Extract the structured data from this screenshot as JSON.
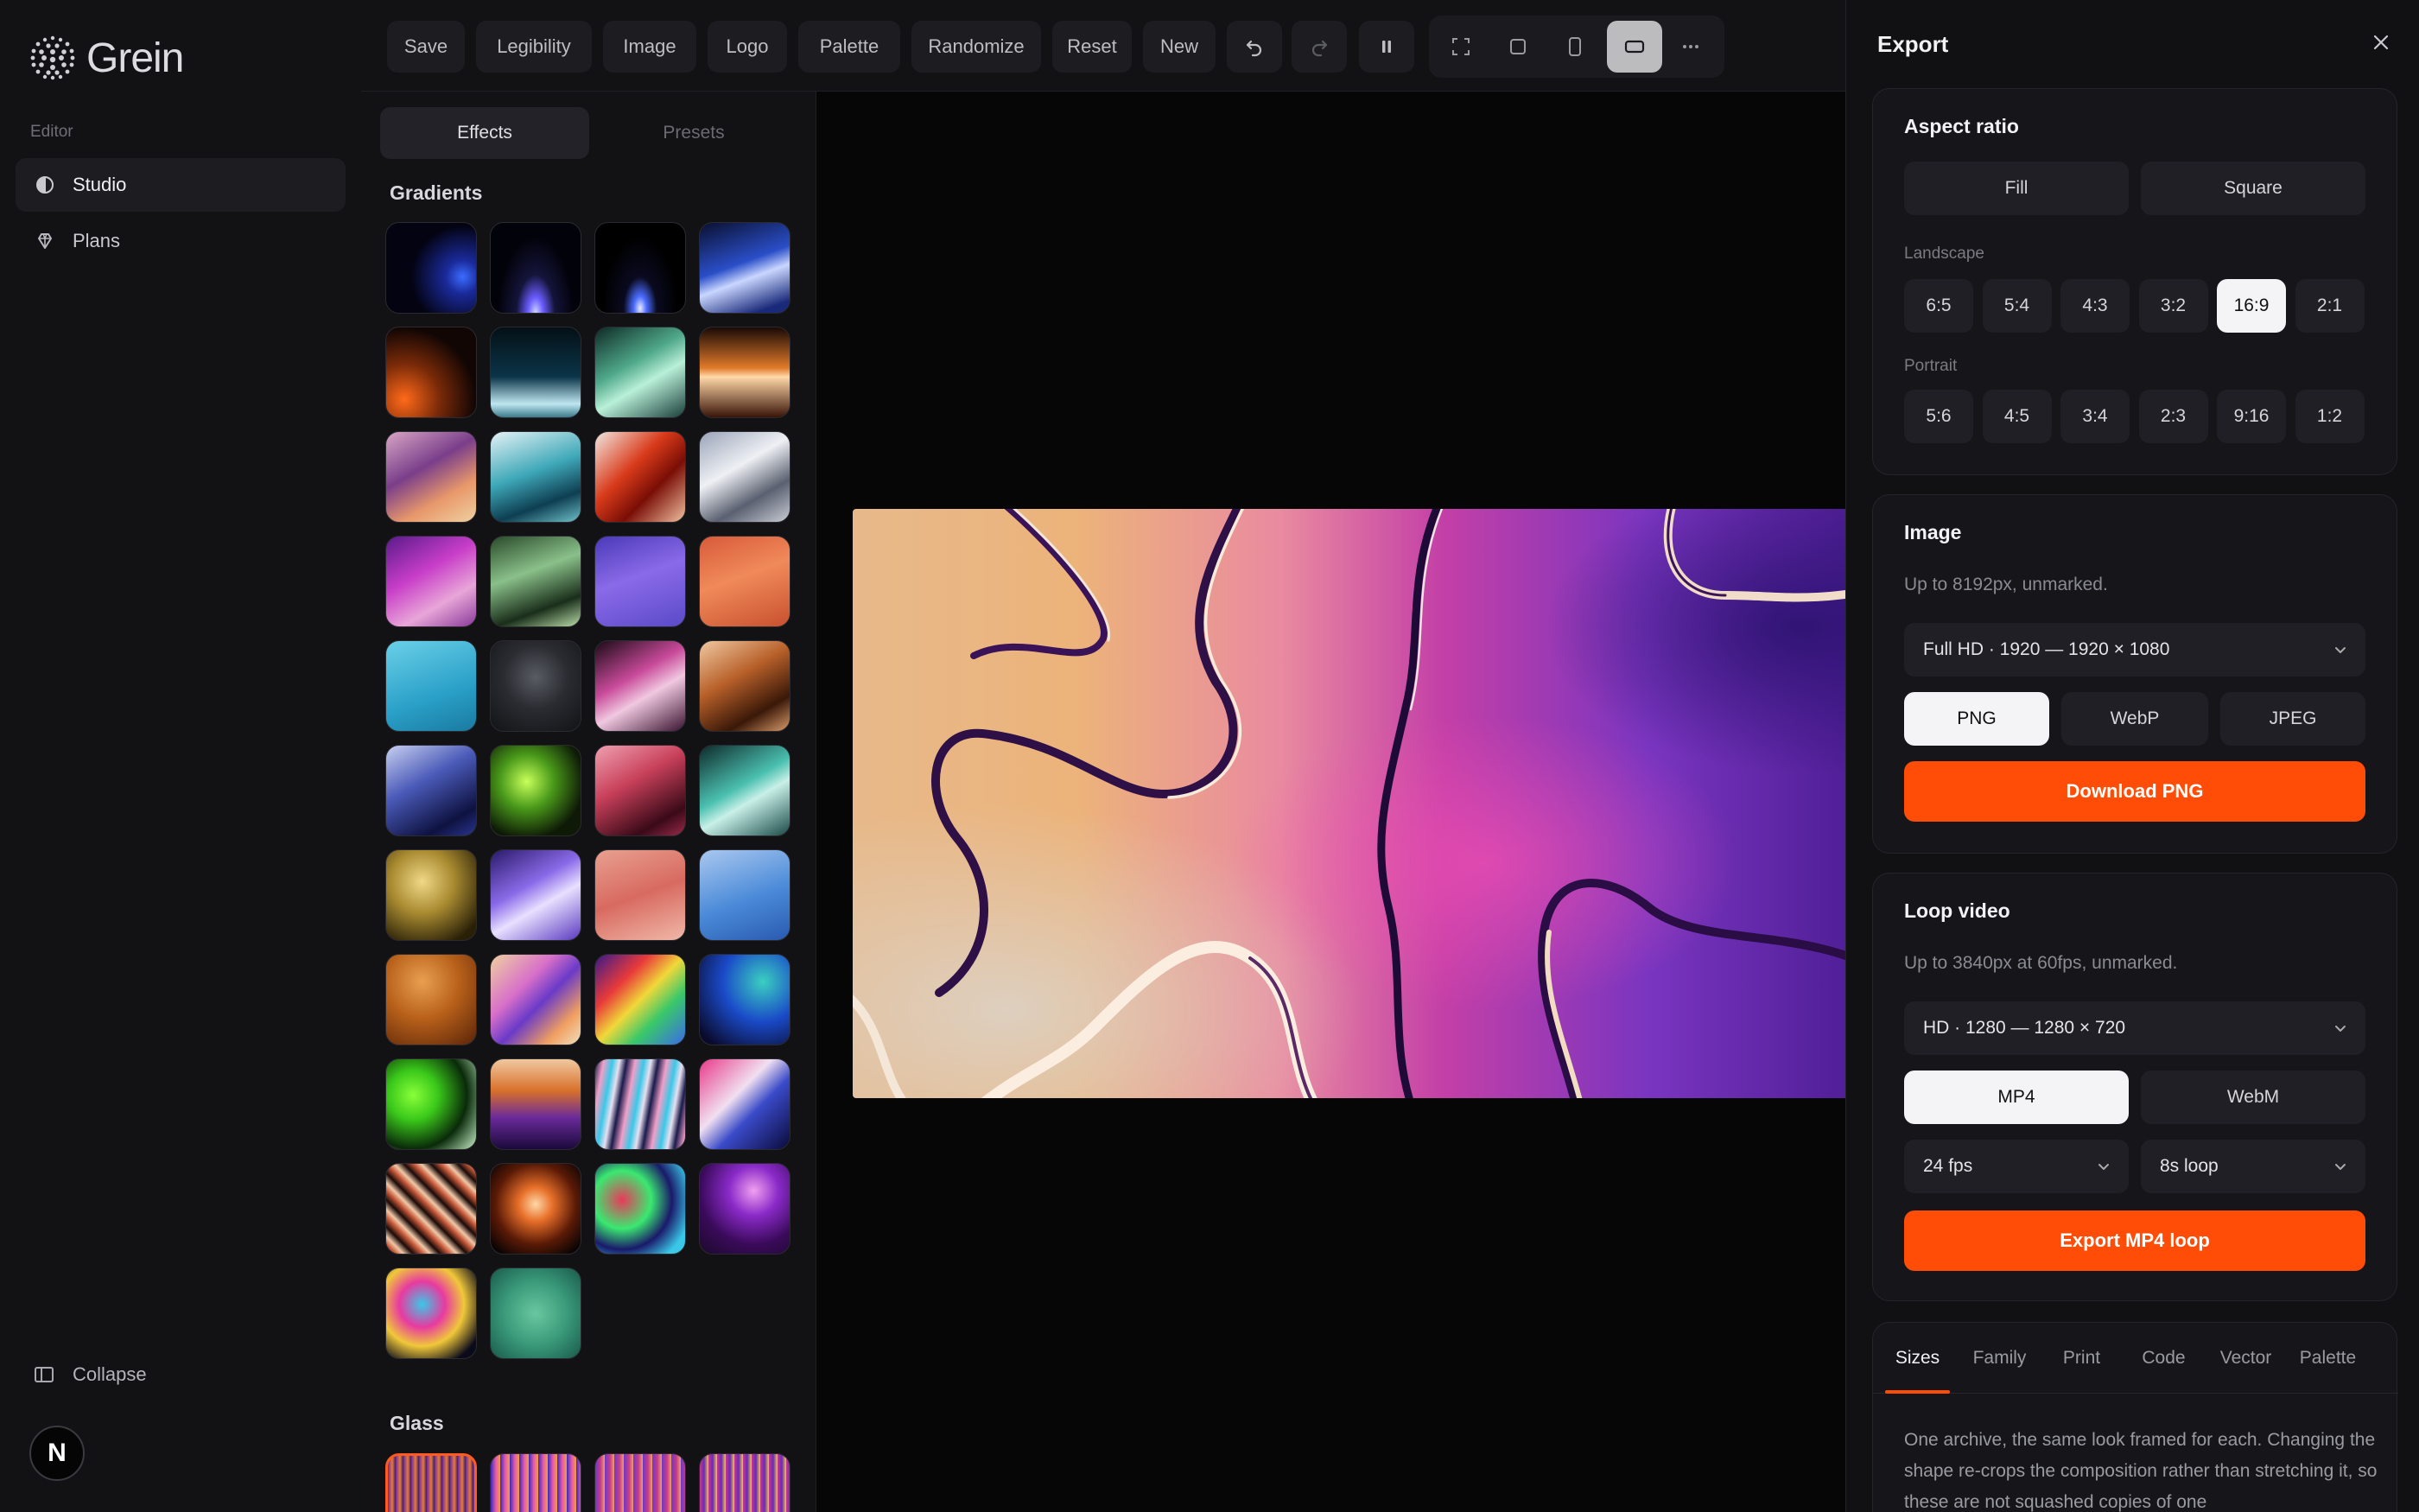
{
  "app": {
    "name": "Grein"
  },
  "sidebar": {
    "section": "Editor",
    "items": [
      {
        "label": "Studio",
        "icon": "studio-icon",
        "active": true
      },
      {
        "label": "Plans",
        "icon": "gem-icon",
        "active": false
      }
    ],
    "collapse_label": "Collapse",
    "avatar_letter": "N"
  },
  "toolbar": {
    "save": "Save",
    "legibility": "Legibility",
    "image": "Image",
    "logo": "Logo",
    "palette": "Palette",
    "randomize": "Randomize",
    "reset": "Reset",
    "new": "New"
  },
  "effects_panel": {
    "tab_effects": "Effects",
    "tab_presets": "Presets",
    "gradients_title": "Gradients",
    "glass_title": "Glass"
  },
  "export": {
    "title": "Export",
    "aspect": {
      "title": "Aspect ratio",
      "fill": "Fill",
      "square": "Square",
      "landscape_label": "Landscape",
      "landscape": [
        "6:5",
        "5:4",
        "4:3",
        "3:2",
        "16:9",
        "2:1"
      ],
      "landscape_selected": "16:9",
      "portrait_label": "Portrait",
      "portrait": [
        "5:6",
        "4:5",
        "3:4",
        "2:3",
        "9:16",
        "1:2"
      ]
    },
    "image": {
      "title": "Image",
      "subtitle": "Up to 8192px, unmarked.",
      "size_value": "Full HD · 1920 — 1920 × 1080",
      "formats": [
        "PNG",
        "WebP",
        "JPEG"
      ],
      "format_selected": "PNG",
      "cta": "Download PNG"
    },
    "video": {
      "title": "Loop video",
      "subtitle": "Up to 3840px at 60fps, unmarked.",
      "size_value": "HD · 1280 — 1280 × 720",
      "formats": [
        "MP4",
        "WebM"
      ],
      "format_selected": "MP4",
      "fps_value": "24 fps",
      "loop_value": "8s loop",
      "cta": "Export MP4 loop"
    },
    "info": {
      "tabs": [
        "Sizes",
        "Family",
        "Print",
        "Code",
        "Vector",
        "Palette"
      ],
      "tab_selected": "Sizes",
      "text": "One archive, the same look framed for each. Changing the shape re-crops the composition rather than stretching it, so these are not squashed copies of one"
    }
  },
  "colors": {
    "accent": "#ff4d07",
    "panel": "#121215",
    "canvas": "#060606"
  }
}
